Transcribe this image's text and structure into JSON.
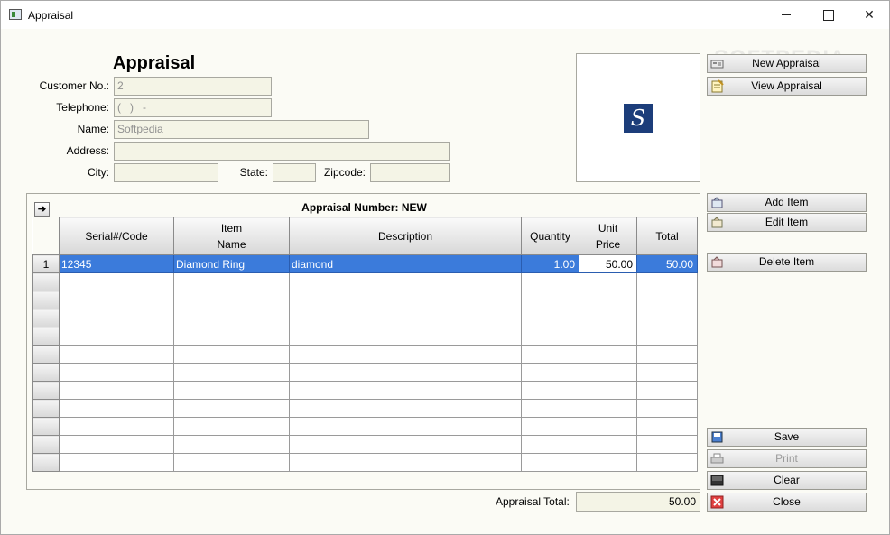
{
  "window": {
    "title": "Appraisal"
  },
  "form": {
    "heading": "Appraisal",
    "customer_no_label": "Customer No.:",
    "customer_no_value": "2",
    "telephone_label": "Telephone:",
    "telephone_value": "(   )   -",
    "name_label": "Name:",
    "name_value": "Softpedia",
    "address_label": "Address:",
    "address_value": "",
    "city_label": "City:",
    "city_value": "",
    "state_label": "State:",
    "state_value": "",
    "zipcode_label": "Zipcode:",
    "zipcode_value": ""
  },
  "logo": {
    "letter": "S"
  },
  "watermark": "SOFTPEDIA",
  "buttons": {
    "new_appraisal": "New Appraisal",
    "view_appraisal": "View Appraisal",
    "add_item": "Add Item",
    "edit_item": "Edit Item",
    "delete_item": "Delete Item",
    "save": "Save",
    "print": "Print",
    "clear": "Clear",
    "close": "Close"
  },
  "grid": {
    "title": "Appraisal Number: NEW",
    "nav_arrow": "➔",
    "columns": {
      "serial": "Serial#/Code",
      "item_name_1": "Item",
      "item_name_2": "Name",
      "description": "Description",
      "quantity": "Quantity",
      "unit_price_1": "Unit",
      "unit_price_2": "Price",
      "total": "Total"
    },
    "rows": [
      {
        "num": "1",
        "serial": "12345",
        "item_name": "Diamond Ring",
        "description": "diamond",
        "quantity": "1.00",
        "unit_price": "50.00",
        "total": "50.00"
      }
    ]
  },
  "footer": {
    "total_label": "Appraisal Total:",
    "total_value": "50.00"
  },
  "colors": {
    "selection": "#3b7bdb",
    "form_bg": "#fbfbf5",
    "logo_bg": "#1c3d7a"
  },
  "icons": [
    "app-icon",
    "minimize-icon",
    "maximize-icon",
    "close-icon",
    "new-appraisal-icon",
    "view-appraisal-icon",
    "add-item-icon",
    "edit-item-icon",
    "delete-item-icon",
    "save-icon",
    "print-icon",
    "clear-icon",
    "close-x-icon"
  ]
}
